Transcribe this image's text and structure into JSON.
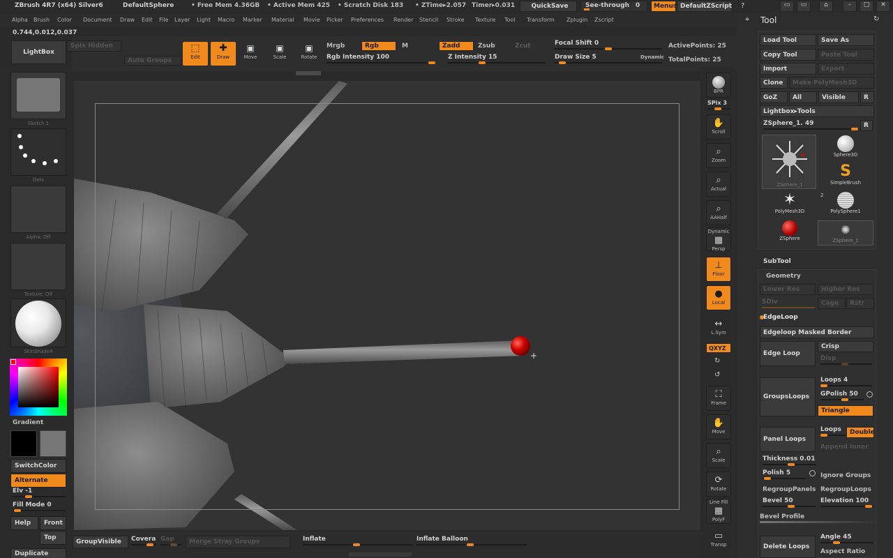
{
  "titlebar": {
    "app": "ZBrush 4R7 (x64) Silver6",
    "document": "DefaultSphere",
    "free_mem": "• Free Mem 4.36GB",
    "active_mem": "• Active Mem 425",
    "scratch": "• Scratch Disk 183",
    "ztime": "• ZTime▸2.057",
    "timer": "Timer▸0.031",
    "quicksave": "QuickSave",
    "see_through": "See-through",
    "see_through_value": "0",
    "menus": "Menus",
    "default_zscript": "DefaultZScript"
  },
  "menubar": {
    "items": [
      "Alpha",
      "Brush",
      "Color",
      "Document",
      "Draw",
      "Edit",
      "File",
      "Layer",
      "Light",
      "Macro",
      "Marker",
      "Material",
      "Movie",
      "Picker",
      "Preferences",
      "Render",
      "Stencil",
      "Stroke",
      "Texture",
      "Tool",
      "Transform",
      "Zplugin",
      "Zscript"
    ]
  },
  "coords": "0.744,0.012,0.037",
  "toolbar": {
    "lightbox": "LightBox",
    "spix_hidden": "Spix Hidden",
    "auto_groups": "Auto Groups",
    "edit": "Edit",
    "draw": "Draw",
    "move": "Move",
    "scale": "Scale",
    "rotate": "Rotate",
    "mrgb": "Mrgb",
    "rgb": "Rgb",
    "m": "M",
    "rgb_intensity": "Rgb Intensity 100",
    "zadd": "Zadd",
    "zsub": "Zsub",
    "zcut": "Zcut",
    "z_intensity": "Z Intensity 15",
    "focal_shift": "Focal Shift 0",
    "draw_size": "Draw Size 5",
    "dynamic": "Dynamic",
    "active_points": "ActivePoints: 25",
    "total_points": "TotalPoints: 25"
  },
  "left": {
    "sketch_label": "Sketch 1",
    "dots_label": "Dots",
    "alpha_label": "Alpha: Off",
    "texture_label": "Texture: Off",
    "material_label": "SkinShade4",
    "gradient": "Gradient",
    "switch_color": "SwitchColor",
    "alternate": "Alternate",
    "elv": "Elv -1",
    "fill_mode": "Fill Mode 0",
    "help": "Help",
    "front": "Front",
    "top": "Top",
    "duplicate": "Duplicate"
  },
  "righttools": {
    "bpr": "BPR",
    "spix": "SPix 3",
    "scroll": "Scroll",
    "zoom": "Zoom",
    "actual": "Actual",
    "aahalf": "AAHalf",
    "dynamic": "Dynamic",
    "persp": "Persp",
    "floor": "Floor",
    "local": "Local",
    "lsym": "L.Sym",
    "xyz": "QXYZ",
    "frame": "Frame",
    "move": "Move",
    "scale": "Scale",
    "rotate": "Rotate",
    "line_fill": "Line Fill",
    "polyf": "PolyF",
    "transp": "Transp"
  },
  "bottombar": {
    "group_visible": "GroupVisible",
    "coverage": "Covera",
    "gap": "Gap",
    "merge_stray": "Merge Stray Groups",
    "inflate": "Inflate",
    "inflate_balloon": "Inflate Balloon"
  },
  "tool_panel": {
    "title": "Tool",
    "load_tool": "Load Tool",
    "save_as": "Save As",
    "copy_tool": "Copy Tool",
    "paste_tool": "Paste Tool",
    "import": "Import",
    "export": "Export",
    "clone": "Clone",
    "make_polymesh": "Make PolyMesh3D",
    "goz": "GoZ",
    "all": "All",
    "visible": "Visible",
    "r": "R",
    "lightbox_tools": "Lightbox▸Tools",
    "zsphere_slider": "ZSphere_1. 49",
    "tools": [
      {
        "name": "ZSphere_1",
        "num": ""
      },
      {
        "name": "Sphere3D",
        "num": ""
      },
      {
        "name": "SimpleBrush",
        "num": ""
      },
      {
        "name": "PolyMesh3D",
        "num": "2"
      },
      {
        "name": "PolySphere1",
        "num": ""
      },
      {
        "name": "ZSphere",
        "num": ""
      },
      {
        "name": "ZSphere_1",
        "num": ""
      }
    ],
    "subtool": "SubTool",
    "geometry": "Geometry",
    "lower_res": "Lower Res",
    "higher_res": "Higher Res",
    "sdiv": "SDiv",
    "cage": "Cage",
    "rstr": "Rstr",
    "edgeloop_header": "EdgeLoop",
    "edgeloop_masked": "Edgeloop Masked Border",
    "edge_loop": "Edge Loop",
    "crisp": "Crisp",
    "disp": "Disp",
    "groups_loops": "GroupsLoops",
    "loops4": "Loops 4",
    "gpolish": "GPolish 50",
    "triangle": "Triangle",
    "panel_loops": "Panel Loops",
    "loops": "Loops",
    "double": "Double",
    "append_inner": "Append Inner",
    "thickness": "Thickness 0.01",
    "polish": "Polish 5",
    "ignore_groups": "Ignore Groups",
    "regroup_panels": "RegroupPanels",
    "regroup_loops": "RegroupLoops",
    "bevel": "Bevel 50",
    "elevation": "Elevation 100",
    "bevel_profile": "Bevel Profile",
    "delete_loops": "Delete Loops",
    "angle": "Angle 45",
    "aspect_ratio": "Aspect Ratio"
  }
}
